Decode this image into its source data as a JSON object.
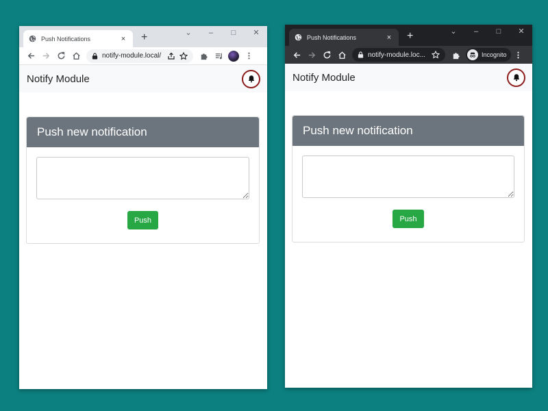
{
  "windows": [
    {
      "theme": "light",
      "tab_title": "Push Notifications",
      "url": "notify-module.local/",
      "incognito_label": ""
    },
    {
      "theme": "dark",
      "tab_title": "Push Notifications",
      "url": "notify-module.loc...",
      "incognito_label": "Incognito"
    }
  ],
  "page": {
    "brand": "Notify Module",
    "card_title": "Push new notification",
    "textarea_value": "",
    "push_label": "Push"
  },
  "icons": {
    "tab_close": "×",
    "new_tab": "+",
    "chevron": "⌄",
    "minimize": "–",
    "maximize": "□",
    "close": "✕"
  },
  "colors": {
    "background": "#0c8080",
    "card_header": "#6c757d",
    "push_button": "#28a745",
    "bell_border": "#8b1a1a"
  }
}
